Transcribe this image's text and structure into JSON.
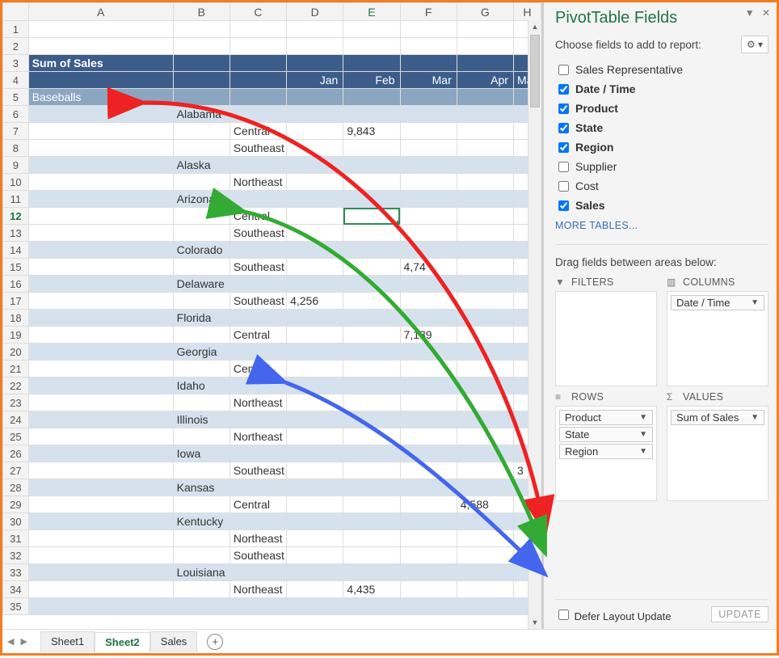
{
  "pane": {
    "title": "PivotTable Fields",
    "subtitle": "Choose fields to add to report:",
    "fields": [
      {
        "label": "Sales Representative",
        "checked": false
      },
      {
        "label": "Date / Time",
        "checked": true
      },
      {
        "label": "Product",
        "checked": true
      },
      {
        "label": "State",
        "checked": true
      },
      {
        "label": "Region",
        "checked": true
      },
      {
        "label": "Supplier",
        "checked": false
      },
      {
        "label": "Cost",
        "checked": false
      },
      {
        "label": "Sales",
        "checked": true
      }
    ],
    "more_tables": "MORE TABLES...",
    "drag_label": "Drag fields between areas below:",
    "areas": {
      "filters": {
        "title": "FILTERS",
        "items": []
      },
      "columns": {
        "title": "COLUMNS",
        "items": [
          "Date / Time"
        ]
      },
      "rows": {
        "title": "ROWS",
        "items": [
          "Product",
          "State",
          "Region"
        ]
      },
      "values": {
        "title": "VALUES",
        "items": [
          "Sum of Sales"
        ]
      }
    },
    "defer_label": "Defer Layout Update",
    "update_label": "UPDATE"
  },
  "tabs": {
    "items": [
      "Sheet1",
      "Sheet2",
      "Sales"
    ],
    "active": 1
  },
  "columns": [
    "A",
    "B",
    "C",
    "D",
    "E",
    "F",
    "G",
    "H"
  ],
  "selected_cell": {
    "row": 12,
    "col": "E"
  },
  "pivot": {
    "title": "Sum of Sales",
    "months": [
      "Jan",
      "Feb",
      "Mar",
      "Apr",
      "May"
    ],
    "product": "Baseballs",
    "rows": [
      {
        "type": "state",
        "label": "Alabama"
      },
      {
        "type": "region",
        "label": "Central",
        "values": {
          "Feb": "9,843"
        }
      },
      {
        "type": "region",
        "label": "Southeast"
      },
      {
        "type": "state",
        "label": "Alaska"
      },
      {
        "type": "region",
        "label": "Northeast"
      },
      {
        "type": "state",
        "label": "Arizona"
      },
      {
        "type": "region",
        "label": "Central"
      },
      {
        "type": "region",
        "label": "Southeast"
      },
      {
        "type": "state",
        "label": "Colorado"
      },
      {
        "type": "region",
        "label": "Southeast",
        "values": {
          "Mar": "4,74"
        }
      },
      {
        "type": "state",
        "label": "Delaware"
      },
      {
        "type": "region",
        "label": "Southeast",
        "values": {
          "Jan": "4,256"
        }
      },
      {
        "type": "state",
        "label": "Florida"
      },
      {
        "type": "region",
        "label": "Central",
        "values": {
          "Mar": "7,139"
        }
      },
      {
        "type": "state",
        "label": "Georgia"
      },
      {
        "type": "region",
        "label": "Central"
      },
      {
        "type": "state",
        "label": "Idaho"
      },
      {
        "type": "region",
        "label": "Northeast"
      },
      {
        "type": "state",
        "label": "Illinois"
      },
      {
        "type": "region",
        "label": "Northeast"
      },
      {
        "type": "state",
        "label": "Iowa"
      },
      {
        "type": "region",
        "label": "Southeast",
        "values": {
          "May": "3"
        }
      },
      {
        "type": "state",
        "label": "Kansas"
      },
      {
        "type": "region",
        "label": "Central",
        "values": {
          "Apr": "4,588"
        }
      },
      {
        "type": "state",
        "label": "Kentucky"
      },
      {
        "type": "region",
        "label": "Northeast"
      },
      {
        "type": "region",
        "label": "Southeast"
      },
      {
        "type": "state",
        "label": "Louisiana"
      },
      {
        "type": "region",
        "label": "Northeast",
        "values": {
          "Feb": "4,435"
        }
      }
    ]
  }
}
